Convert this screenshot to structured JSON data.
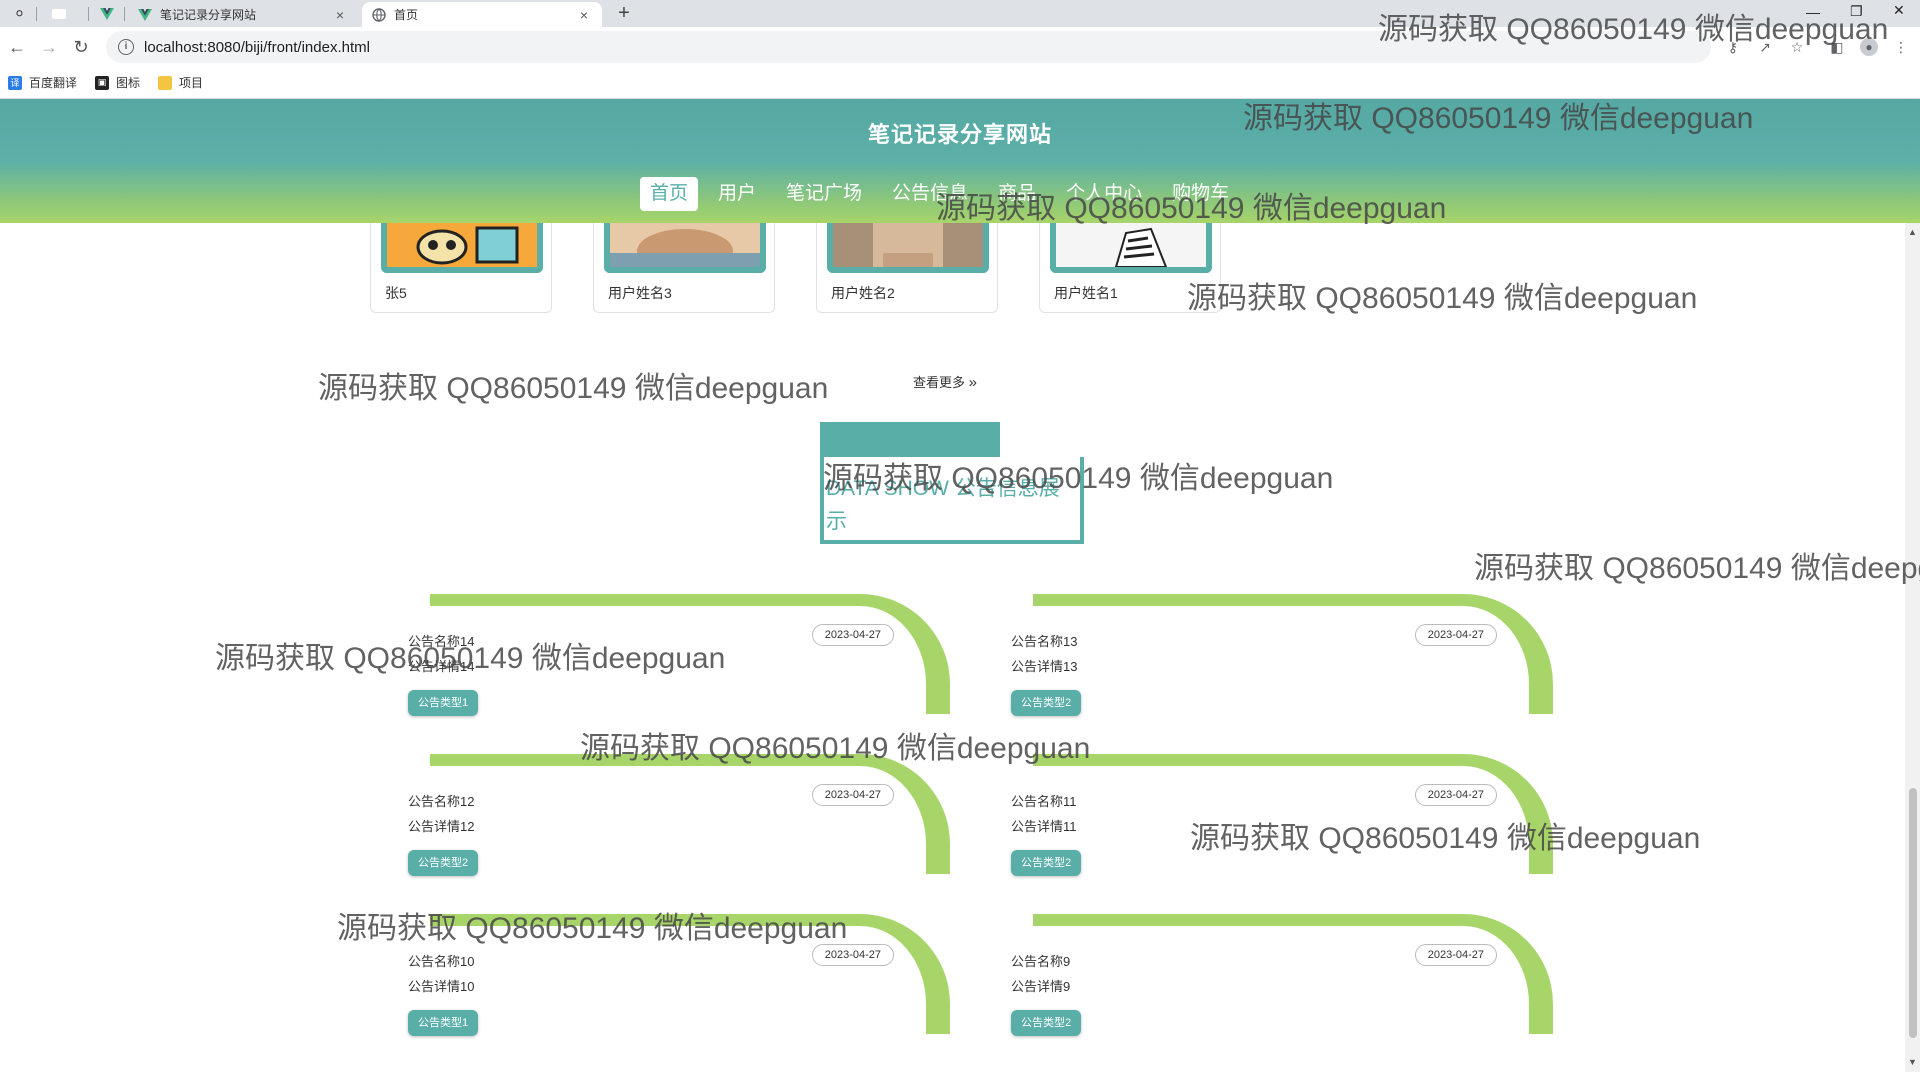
{
  "browser": {
    "tabs": [
      {
        "title": "笔记记录分享网站",
        "favicon": "vue-icon",
        "active": false
      },
      {
        "title": "首页",
        "favicon": "globe-icon",
        "active": true
      }
    ],
    "new_tab": "+",
    "url": "localhost:8080/biji/front/index.html",
    "bookmarks": [
      {
        "label": "百度翻译",
        "icon": "translate-icon",
        "color": "#2b7de9"
      },
      {
        "label": "图标",
        "icon": "image-icon",
        "color": "#222222"
      },
      {
        "label": "项目",
        "icon": "folder-icon",
        "color": "#f4c542"
      }
    ]
  },
  "site": {
    "title": "笔记记录分享网站",
    "nav": [
      {
        "label": "首页",
        "active": true
      },
      {
        "label": "用户",
        "active": false
      },
      {
        "label": "笔记广场",
        "active": false
      },
      {
        "label": "公告信息",
        "active": false
      },
      {
        "label": "商品",
        "active": false
      },
      {
        "label": "个人中心",
        "active": false
      },
      {
        "label": "购物车",
        "active": false
      }
    ],
    "colors": {
      "primary": "#5aaea8",
      "accent": "#a8d56a"
    }
  },
  "users": [
    {
      "name": "张5"
    },
    {
      "name": "用户姓名3"
    },
    {
      "name": "用户姓名2"
    },
    {
      "name": "用户姓名1"
    }
  ],
  "more_label": "查看更多",
  "notice_section_title": "DATA SHOW 公告信息展示",
  "notices": [
    {
      "title": "公告名称14",
      "detail": "公告详情14",
      "date": "2023-04-27",
      "type": "公告类型1"
    },
    {
      "title": "公告名称13",
      "detail": "公告详情13",
      "date": "2023-04-27",
      "type": "公告类型2"
    },
    {
      "title": "公告名称12",
      "detail": "公告详情12",
      "date": "2023-04-27",
      "type": "公告类型2"
    },
    {
      "title": "公告名称11",
      "detail": "公告详情11",
      "date": "2023-04-27",
      "type": "公告类型2"
    },
    {
      "title": "公告名称10",
      "detail": "公告详情10",
      "date": "2023-04-27",
      "type": "公告类型1"
    },
    {
      "title": "公告名称9",
      "detail": "公告详情9",
      "date": "2023-04-27",
      "type": "公告类型2"
    }
  ],
  "watermark": "源码获取 QQ86050149 微信deepguan"
}
